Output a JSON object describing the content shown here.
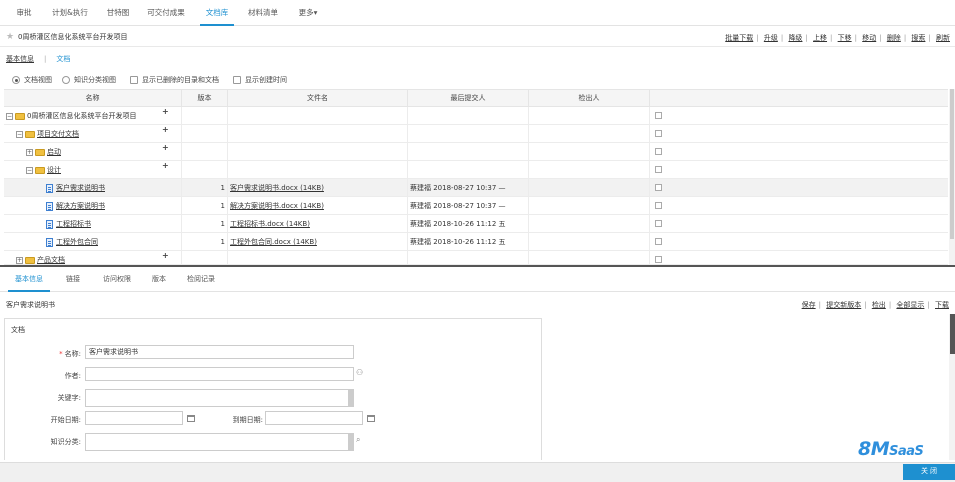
{
  "top_tabs": [
    {
      "label": "审批"
    },
    {
      "label": "计划&执行"
    },
    {
      "label": "甘特图"
    },
    {
      "label": "可交付成果"
    },
    {
      "label": "文档库"
    },
    {
      "label": "材料清单"
    },
    {
      "label": "更多▾"
    }
  ],
  "active_top_tab": "文档库",
  "header": {
    "title": "0周桥灌区信息化系统平台开发项目",
    "actions": [
      "批量下载",
      "升级",
      "降级",
      "上移",
      "下移",
      "移动",
      "删除",
      "搜索",
      "刷新"
    ]
  },
  "subtabs": {
    "tab1": "基本信息",
    "sep": "|",
    "tab2": "文档"
  },
  "view_options": {
    "doc_view": "文档视图",
    "kb_view": "知识分类视图",
    "show_deleted": "显示已删除的目录和文档",
    "show_created": "显示创建时间"
  },
  "table": {
    "headers": [
      "名称",
      "版本",
      "文件名",
      "最后提交人",
      "检出人"
    ],
    "rows": [
      {
        "name": "0周桥灌区信息化系统平台开发项目",
        "version": "",
        "file": "",
        "submitter": "",
        "checkout": "",
        "plus": "+"
      },
      {
        "name": "项目交付文档",
        "version": "",
        "file": "",
        "submitter": "",
        "checkout": "",
        "plus": "+"
      },
      {
        "name": "启动",
        "version": "",
        "file": "",
        "submitter": "",
        "checkout": "",
        "plus": "+"
      },
      {
        "name": "设计",
        "version": "",
        "file": "",
        "submitter": "",
        "checkout": "",
        "plus": "+"
      },
      {
        "name": "客户需求说明书",
        "version": "1",
        "file": "客户需求说明书.docx (14KB)",
        "submitter": "蔡建福 2018-08-27 10:37 —",
        "checkout": "",
        "plus": ""
      },
      {
        "name": "解决方案说明书",
        "version": "1",
        "file": "解决方案说明书.docx (14KB)",
        "submitter": "蔡建福 2018-08-27 10:37 —",
        "checkout": "",
        "plus": ""
      },
      {
        "name": "工程招标书",
        "version": "1",
        "file": "工程招标书.docx (14KB)",
        "submitter": "蔡建福 2018-10-26 11:12 五",
        "checkout": "",
        "plus": ""
      },
      {
        "name": "工程外包合同",
        "version": "1",
        "file": "工程外包合同.docx (14KB)",
        "submitter": "蔡建福 2018-10-26 11:12 五",
        "checkout": "",
        "plus": ""
      },
      {
        "name": "产品文档",
        "version": "",
        "file": "",
        "submitter": "",
        "checkout": "",
        "plus": "+"
      }
    ]
  },
  "bottom_tabs": [
    {
      "label": "基本信息"
    },
    {
      "label": "链接"
    },
    {
      "label": "访问权限"
    },
    {
      "label": "版本"
    },
    {
      "label": "检阅记录"
    }
  ],
  "bottom_header": {
    "title": "客户需求说明书",
    "actions": [
      "保存",
      "提交新版本",
      "检出",
      "全部显示",
      "下载"
    ]
  },
  "form": {
    "section_title": "文档",
    "name_label": "名称:",
    "name_value": "客户需求说明书",
    "author_label": "作者:",
    "author_value": "",
    "keyword_label": "关键字:",
    "keyword_value": "",
    "start_label": "开始日期:",
    "start_value": "",
    "due_label": "到期日期:",
    "due_value": "",
    "kb_label": "知识分类:",
    "kb_value": ""
  },
  "footer": {
    "close_label": "关 闭",
    "logo_big": "8M",
    "logo_small": "SaaS"
  }
}
